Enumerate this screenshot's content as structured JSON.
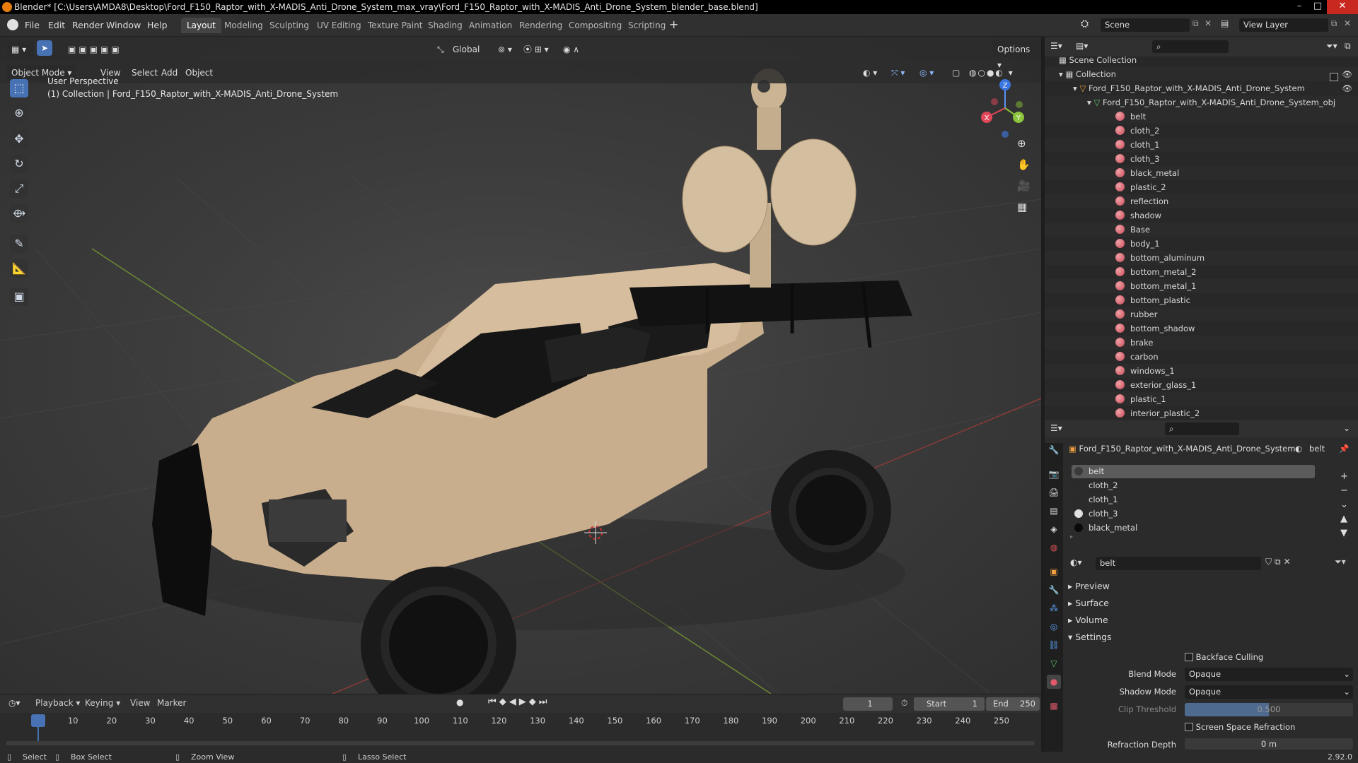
{
  "window": {
    "title": "Blender* [C:\\Users\\AMDA8\\Desktop\\Ford_F150_Raptor_with_X-MADIS_Anti_Drone_System_max_vray\\Ford_F150_Raptor_with_X-MADIS_Anti_Drone_System_blender_base.blend]"
  },
  "menu": [
    "File",
    "Edit",
    "Render",
    "Window",
    "Help"
  ],
  "workspaces": [
    "Layout",
    "Modeling",
    "Sculpting",
    "UV Editing",
    "Texture Paint",
    "Shading",
    "Animation",
    "Rendering",
    "Compositing",
    "Scripting"
  ],
  "scene": {
    "label": "Scene",
    "view_layer": "View Layer"
  },
  "viewport": {
    "mode": "Object Mode",
    "menus": [
      "View",
      "Select",
      "Add",
      "Object"
    ],
    "orientation": "Global",
    "options": "Options",
    "perspective": "User Perspective",
    "collection_info": "(1) Collection | Ford_F150_Raptor_with_X-MADIS_Anti_Drone_System",
    "gizmo": {
      "x": "X",
      "y": "Y",
      "z": "Z"
    }
  },
  "outliner": {
    "scene_collection": "Scene Collection",
    "collection": "Collection",
    "object": "Ford_F150_Raptor_with_X-MADIS_Anti_Drone_System",
    "mesh": "Ford_F150_Raptor_with_X-MADIS_Anti_Drone_System_obj",
    "materials": [
      "belt",
      "cloth_2",
      "cloth_1",
      "cloth_3",
      "black_metal",
      "plastic_2",
      "reflection",
      "shadow",
      "Base",
      "body_1",
      "bottom_aluminum",
      "bottom_metal_2",
      "bottom_metal_1",
      "bottom_plastic",
      "rubber",
      "bottom_shadow",
      "brake",
      "carbon",
      "windows_1",
      "exterior_glass_1",
      "plastic_1",
      "interior_plastic_2"
    ]
  },
  "properties": {
    "object": "Ford_F150_Raptor_with_X-MADIS_Anti_Drone_System",
    "material": "belt",
    "slots": [
      {
        "name": "belt",
        "color": "#3a3a3a"
      },
      {
        "name": "cloth_2",
        "color": "#2a2a2a"
      },
      {
        "name": "cloth_1",
        "color": "#2a2a2a"
      },
      {
        "name": "cloth_3",
        "color": "#e0e0e0"
      },
      {
        "name": "black_metal",
        "color": "#0a0a0a"
      }
    ],
    "material_field": "belt",
    "panels": [
      "Preview",
      "Surface",
      "Volume",
      "Settings"
    ],
    "backface_culling": "Backface Culling",
    "blend_mode_label": "Blend Mode",
    "blend_mode": "Opaque",
    "shadow_mode_label": "Shadow Mode",
    "shadow_mode": "Opaque",
    "clip_threshold_label": "Clip Threshold",
    "clip_threshold": "0.500",
    "clip_fraction": 0.5,
    "ssr": "Screen Space Refraction",
    "refraction_depth_label": "Refraction Depth",
    "refraction_depth": "0 m"
  },
  "timeline": {
    "menus": [
      "Playback",
      "Keying",
      "View",
      "Marker"
    ],
    "current_frame": "1",
    "start_label": "Start",
    "start": "1",
    "end_label": "End",
    "end": "250",
    "ticks": [
      "1",
      "10",
      "20",
      "30",
      "40",
      "50",
      "60",
      "70",
      "80",
      "90",
      "100",
      "110",
      "120",
      "130",
      "140",
      "150",
      "160",
      "170",
      "180",
      "190",
      "200",
      "210",
      "220",
      "230",
      "240",
      "250"
    ]
  },
  "status": {
    "select": "Select",
    "box_select": "Box Select",
    "zoom_view": "Zoom View",
    "lasso_select": "Lasso Select",
    "version": "2.92.0"
  },
  "colors": {
    "accent": "#4772b3",
    "body": "#d5bc9a",
    "logo": "#e87d0d"
  }
}
